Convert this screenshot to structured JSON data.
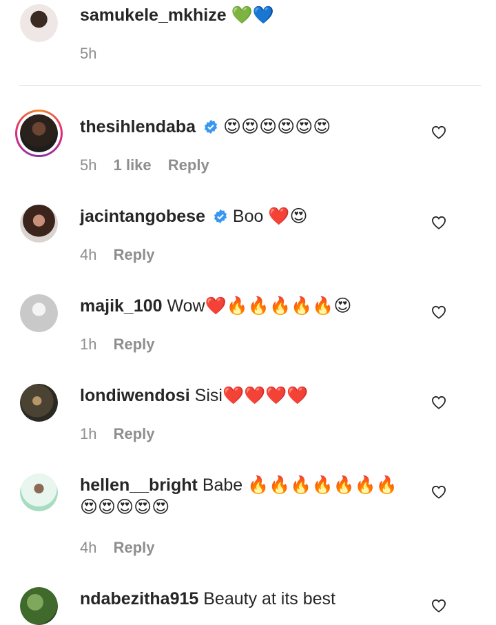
{
  "comments": [
    {
      "username": "samukele_mkhize",
      "text": "💚💙",
      "time": "5h",
      "likes": "",
      "reply": "",
      "avatar_color": "#d7c9c6",
      "verified": false
    },
    {
      "username": "thesihlendaba",
      "text": "😍😍😍😍😍😍",
      "time": "5h",
      "likes": "1 like",
      "reply": "Reply",
      "avatar_color": "#5a3b2c",
      "verified": true
    },
    {
      "username": "jacintangobese",
      "text": "Boo ❤️😍",
      "time": "4h",
      "likes": "",
      "reply": "Reply",
      "avatar_color": "#8a5a48",
      "verified": true
    },
    {
      "username": "majik_100",
      "text": "Wow❤️🔥🔥🔥🔥🔥😍",
      "time": "1h",
      "likes": "",
      "reply": "Reply",
      "avatar_color": "#cfcfcf",
      "verified": false
    },
    {
      "username": "londiwendosi",
      "text": "Sisi❤️❤️❤️❤️",
      "time": "1h",
      "likes": "",
      "reply": "Reply",
      "avatar_color": "#3b3a2e",
      "verified": false
    },
    {
      "username": "hellen__bright",
      "text": "Babe 🔥🔥🔥🔥🔥🔥🔥😍😍😍😍😍",
      "time": "4h",
      "likes": "",
      "reply": "Reply",
      "avatar_color": "#bfe3cf",
      "verified": false
    },
    {
      "username": "ndabezitha915",
      "text": "Beauty at its best",
      "time": "",
      "likes": "",
      "reply": "",
      "avatar_color": "#4f7a3a",
      "verified": false
    }
  ],
  "colors": {
    "verified_blue": "#3897f0",
    "meta_gray": "#8e8e8e",
    "divider": "#dbdbdb"
  },
  "icons": {
    "like": "heart-outline-icon",
    "verified": "verified-badge-icon"
  }
}
